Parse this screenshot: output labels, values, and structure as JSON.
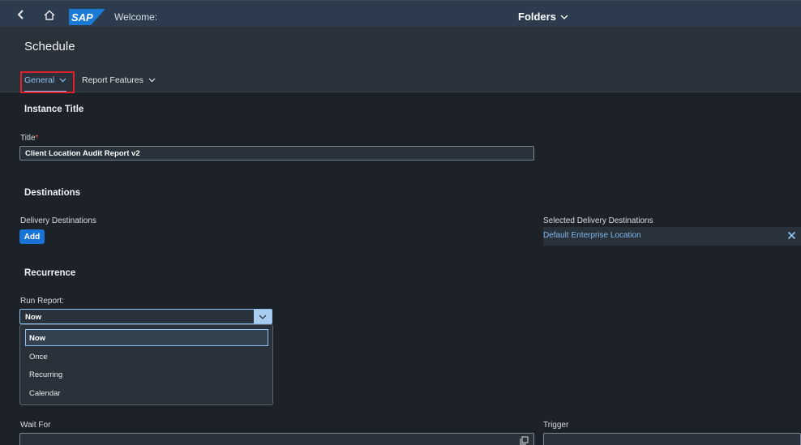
{
  "shell": {
    "logo_text": "SAP",
    "welcome": "Welcome:",
    "folders": "Folders",
    "accent": "#2c3b4e"
  },
  "header": {
    "title": "Schedule",
    "tabs": [
      {
        "label": "General",
        "selected": true
      },
      {
        "label": "Report Features",
        "selected": false
      }
    ]
  },
  "instance": {
    "section": "Instance Title",
    "title_label": "Title",
    "required_mark": "*",
    "title_value": "Client Location Audit Report v2"
  },
  "destinations": {
    "section": "Destinations",
    "delivery_label": "Delivery Destinations",
    "add_label": "Add",
    "selected_label": "Selected Delivery Destinations",
    "selected_items": [
      "Default Enterprise Location"
    ]
  },
  "recurrence": {
    "section": "Recurrence",
    "run_report_label": "Run Report:",
    "run_report_value": "Now",
    "options": [
      "Now",
      "Once",
      "Recurring",
      "Calendar"
    ]
  },
  "events": {
    "wait_for_label": "Wait For",
    "trigger_label": "Trigger"
  },
  "colors": {
    "link": "#7fb8ec",
    "button": "#1873d6",
    "highlight_box": "#e0202a"
  }
}
